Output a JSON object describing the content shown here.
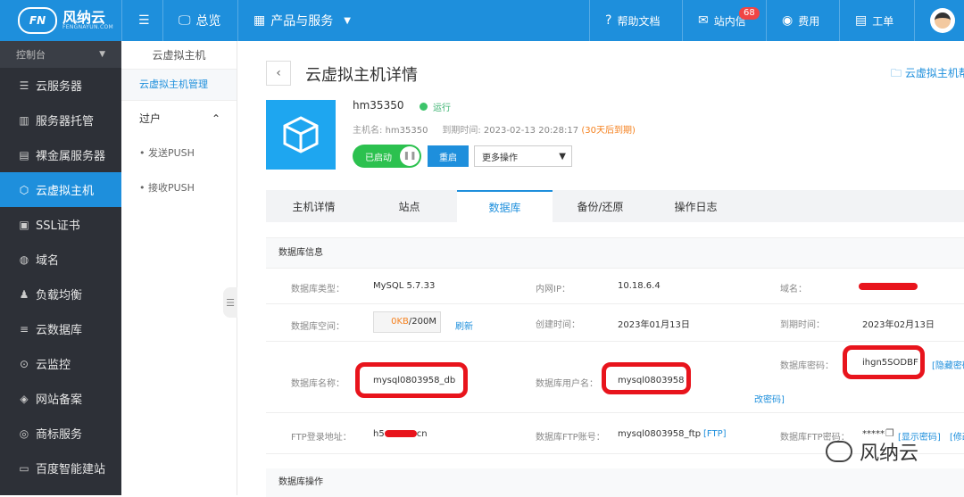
{
  "topbar": {
    "logo": {
      "name": "风纳云",
      "sub": "FENGNAYUN.COM",
      "mark": "FN"
    },
    "menu_icon": "menu-icon",
    "overview": "总览",
    "products": "产品与服务",
    "help_docs": "帮助文档",
    "messages": "站内信",
    "messages_badge": "68",
    "fees": "费用",
    "tickets": "工单"
  },
  "sidebar": {
    "header": "控制台",
    "items": [
      {
        "label": "云服务器",
        "icon": "server-icon"
      },
      {
        "label": "服务器托管",
        "icon": "hosting-icon"
      },
      {
        "label": "裸金属服务器",
        "icon": "baremetal-icon"
      },
      {
        "label": "云虚拟主机",
        "icon": "cube-icon",
        "active": true
      },
      {
        "label": "SSL证书",
        "icon": "certificate-icon"
      },
      {
        "label": "域名",
        "icon": "globe-icon"
      },
      {
        "label": "负载均衡",
        "icon": "balance-icon"
      },
      {
        "label": "云数据库",
        "icon": "database-icon"
      },
      {
        "label": "云监控",
        "icon": "monitor-icon"
      },
      {
        "label": "网站备案",
        "icon": "record-icon"
      },
      {
        "label": "商标服务",
        "icon": "trademark-icon"
      },
      {
        "label": "百度智能建站",
        "icon": "site-builder-icon"
      }
    ]
  },
  "subnav": {
    "title": "云虚拟主机",
    "manage": "云虚拟主机管理",
    "group": "过户",
    "items": [
      "发送PUSH",
      "接收PUSH"
    ]
  },
  "page": {
    "title": "云虚拟主机详情",
    "help_link": "云虚拟主机帮",
    "host_name": "hm35350",
    "status": "运行",
    "hostname_label": "主机名:",
    "hostname_value": "hm35350",
    "expire_label": "到期时间:",
    "expire_value": "2023-02-13 20:28:17",
    "expire_warn": "(30天后到期)",
    "toggle_label": "已启动",
    "restart": "重启",
    "more_ops": "更多操作"
  },
  "tabs": [
    "主机详情",
    "站点",
    "数据库",
    "备份/还原",
    "操作日志"
  ],
  "db": {
    "section_title": "数据库信息",
    "type_label": "数据库类型：",
    "type_value": "MySQL 5.7.33",
    "ip_label": "内网IP：",
    "ip_value": "10.18.6.4",
    "domain_label": "域名：",
    "space_label": "数据库空间：",
    "space_used": "0KB",
    "space_total": "/200M",
    "space_used_fraction": 0,
    "refresh": "刷新",
    "created_label": "创建时间：",
    "created_value": "2023年01月13日",
    "expire_label": "到期时间：",
    "expire_value": "2023年02月13日",
    "password_label": "数据库密码：",
    "password_value": "ihgn5SODBF",
    "hide_password": "[隐藏密码",
    "name_label": "数据库名称：",
    "name_value": "mysql0803958_db",
    "user_label": "数据库用户名：",
    "user_value": "mysql0803958",
    "change_password": "改密码]",
    "ftp_label": "FTP登录地址：",
    "ftp_prefix": "h5",
    "ftp_suffix": "cn",
    "ftp_account_label": "数据库FTP账号：",
    "ftp_account_value": "mysql0803958_ftp",
    "ftp_tag": "[FTP]",
    "ftp_password_label": "数据库FTP密码：",
    "ftp_password_value": "*****",
    "show_password": "[显示密码]",
    "modify": "[修改",
    "ops_title": "数据库操作"
  },
  "watermark": "风纳云"
}
